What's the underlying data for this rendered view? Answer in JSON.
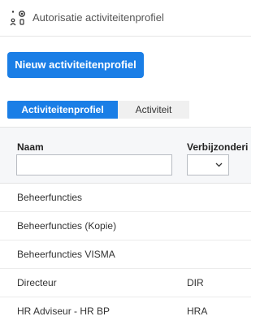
{
  "header": {
    "title": "Autorisatie activiteitenprofiel",
    "icon": "user-settings-icon"
  },
  "actions": {
    "new_button_label": "Nieuw activiteitenprofiel"
  },
  "tabs": [
    {
      "label": "Activiteitenprofiel",
      "active": true
    },
    {
      "label": "Activiteit",
      "active": false
    }
  ],
  "table": {
    "columns": [
      "Naam",
      "Verbijzonderi"
    ],
    "filters": {
      "naam_value": "",
      "verbijzondering_selected": ""
    },
    "rows": [
      {
        "naam": "Beheerfuncties",
        "verbijzondering": ""
      },
      {
        "naam": "Beheerfuncties (Kopie)",
        "verbijzondering": ""
      },
      {
        "naam": "Beheerfuncties VISMA",
        "verbijzondering": ""
      },
      {
        "naam": "Directeur",
        "verbijzondering": "DIR"
      },
      {
        "naam": "HR Adviseur - HR BP",
        "verbijzondering": "HRA"
      }
    ]
  },
  "colors": {
    "accent": "#1a7ee6",
    "header_bg": "#f6f7f9",
    "inactive_tab": "#f0f0f0"
  }
}
